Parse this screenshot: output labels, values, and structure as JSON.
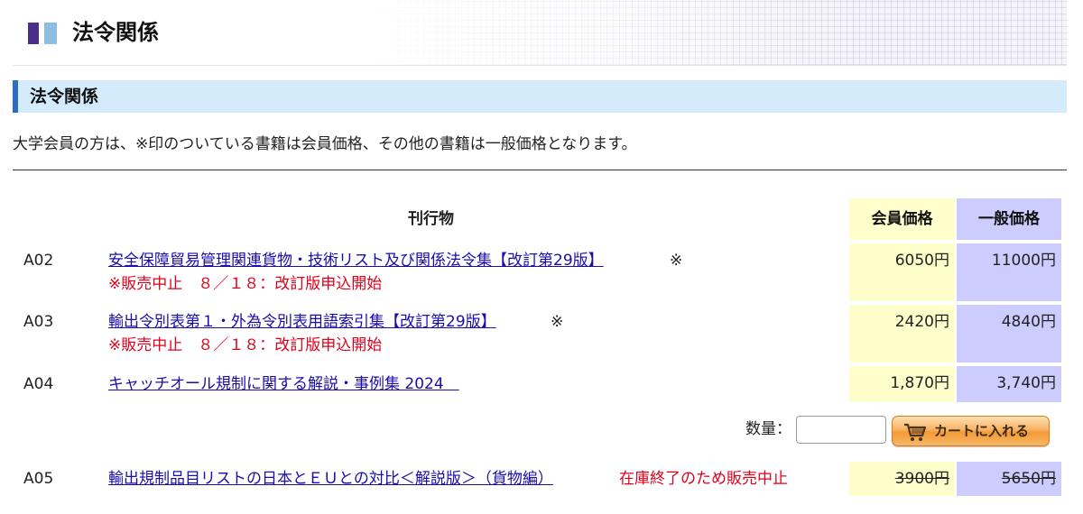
{
  "page": {
    "title": "法令関係"
  },
  "section": {
    "title": "法令関係"
  },
  "notice": "大学会員の方は、※印のついている書籍は会員価格、その他の書籍は一般価格となります。",
  "table": {
    "pub_header": "刊行物",
    "member_header": "会員価格",
    "general_header": "一般価格"
  },
  "items": [
    {
      "code": "A02",
      "title": "安全保障貿易管理関連貨物・技術リスト及び関係法令集【改訂第29版】",
      "mark": "※",
      "status": "※販売中止　８／１８：改訂版申込開始",
      "member_price": "6050円",
      "general_price": "11000円"
    },
    {
      "code": "A03",
      "title": "輸出令別表第１・外為令別表用語索引集【改訂第29版】",
      "mark": "※",
      "status": "※販売中止　８／１８：改訂版申込開始",
      "member_price": "2420円",
      "general_price": "4840円"
    },
    {
      "code": "A04",
      "title": "キャッチオール規制に関する解説・事例集 2024　",
      "mark": "",
      "status": "",
      "member_price": "1,870円",
      "general_price": "3,740円"
    },
    {
      "code": "A05",
      "title": "輸出規制品目リストの日本とＥＵとの対比＜解説版＞（貨物編）",
      "mark": "",
      "status": "在庫終了のため販売中止",
      "member_price": "3900円",
      "general_price": "5650円"
    }
  ],
  "order": {
    "quantity_label": "数量：",
    "quantity_value": "",
    "cart_button_label": "カートに入れる"
  },
  "colors": {
    "member_col": "#ffffcc",
    "general_col": "#ccccff",
    "link": "#1a0dab",
    "alert": "#e0001b",
    "section_bg": "#d4ebfb",
    "section_accent": "#2d6cc0"
  }
}
